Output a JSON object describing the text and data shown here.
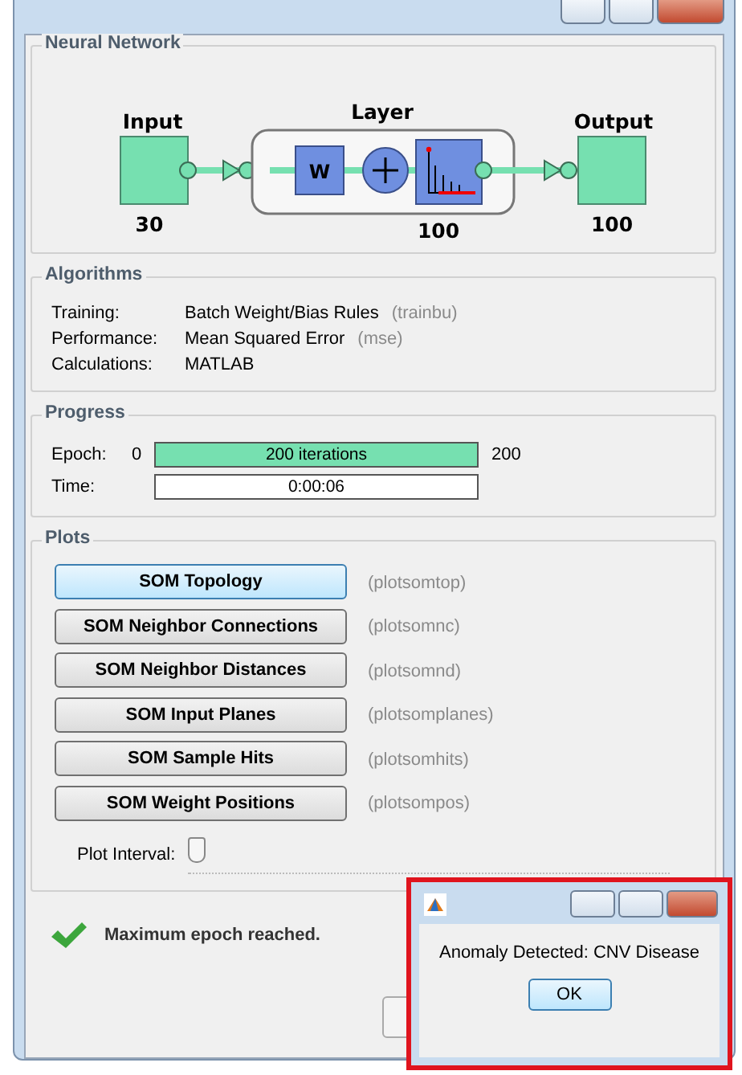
{
  "network": {
    "title": "Neural Network",
    "input_label": "Input",
    "input_size": "30",
    "layer_label": "Layer",
    "weight_symbol": "W",
    "layer_size": "100",
    "output_label": "Output",
    "output_size": "100"
  },
  "algorithms": {
    "title": "Algorithms",
    "rows": [
      {
        "label": "Training:",
        "value": "Batch Weight/Bias Rules",
        "code": "(trainbu)"
      },
      {
        "label": "Performance:",
        "value": "Mean Squared Error",
        "code": "(mse)"
      },
      {
        "label": "Calculations:",
        "value": "MATLAB"
      }
    ]
  },
  "progress": {
    "title": "Progress",
    "rows": [
      {
        "label": "Epoch:",
        "start": "0",
        "text": "200 iterations",
        "level": 1,
        "end": "200"
      },
      {
        "label": "Time:",
        "text": "0:00:06"
      }
    ]
  },
  "plots": {
    "title": "Plots",
    "buttons": [
      {
        "label": "SOM Topology",
        "code": "(plotsomtop)",
        "selected": true
      },
      {
        "label": "SOM Neighbor Connections",
        "code": "(plotsomnc)",
        "selected": false
      },
      {
        "label": "SOM Neighbor Distances",
        "code": "(plotsomnd)",
        "selected": false
      },
      {
        "label": "SOM Input Planes",
        "code": "(plotsomplanes)",
        "selected": false
      },
      {
        "label": "SOM Sample Hits",
        "code": "(plotsomhits)",
        "selected": false
      },
      {
        "label": "SOM Weight Positions",
        "code": "(plotsompos)",
        "selected": false
      }
    ],
    "interval_label": "Plot Interval:",
    "interval": {
      "level": 0
    }
  },
  "status": {
    "text": "Maximum epoch reached."
  },
  "dialog": {
    "message": "Anomaly Detected: CNV Disease",
    "button": "OK"
  }
}
